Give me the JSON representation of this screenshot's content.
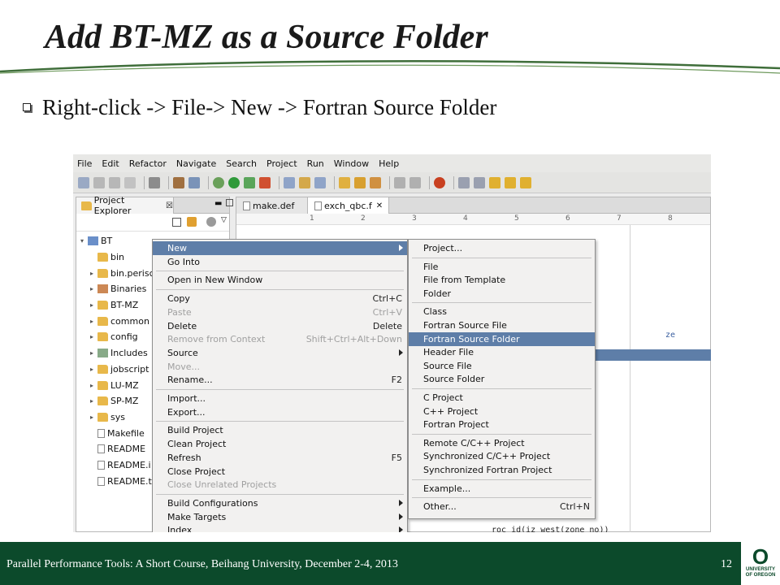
{
  "slide": {
    "title": "Add BT-MZ as a Source Folder",
    "bullet": "Right-click -> File-> New -> Fortran Source Folder",
    "footer": "Parallel Performance Tools: A Short Course, Beihang University, December 2-4, 2013",
    "page_number": "12",
    "logo_letter": "O",
    "logo_line1": "UNIVERSITY",
    "logo_line2": "OF OREGON",
    "colors": {
      "footer_bg": "#0c4a2b",
      "swoosh": "#3f6e3a",
      "highlight": "#5e7ea8"
    }
  },
  "ide": {
    "menubar": [
      "File",
      "Edit",
      "Refactor",
      "Navigate",
      "Search",
      "Project",
      "Run",
      "Window",
      "Help"
    ],
    "project_explorer": {
      "tab_label": "Project Explorer",
      "close_glyph": "☒",
      "items": [
        "BT",
        "bin",
        "bin.perisc",
        "Binaries",
        "BT-MZ",
        "common",
        "config",
        "Includes",
        "jobscript",
        "LU-MZ",
        "SP-MZ",
        "sys",
        "Makefile",
        "README",
        "README.i",
        "README.t"
      ]
    },
    "editor": {
      "tabs": [
        "make.def",
        "exch_qbc.f"
      ],
      "ruler": [
        "1",
        "2",
        "3",
        "4",
        "5",
        "6",
        "7",
        "8"
      ],
      "snippet_right": "ze",
      "snippet_bottom": "roc_id(iz_west(zone_no))"
    },
    "context_menu": [
      {
        "label": "New",
        "accel": "",
        "submenu": true,
        "highlight": true
      },
      {
        "label": "Go Into",
        "accel": ""
      },
      {
        "sep": true
      },
      {
        "label": "Open in New Window",
        "accel": ""
      },
      {
        "sep": true
      },
      {
        "label": "Copy",
        "accel": "Ctrl+C"
      },
      {
        "label": "Paste",
        "accel": "Ctrl+V",
        "disabled": true
      },
      {
        "label": "Delete",
        "accel": "Delete"
      },
      {
        "label": "Remove from Context",
        "accel": "Shift+Ctrl+Alt+Down",
        "disabled": true
      },
      {
        "label": "Source",
        "accel": "",
        "submenu": true
      },
      {
        "label": "Move...",
        "accel": "",
        "disabled": true
      },
      {
        "label": "Rename...",
        "accel": "F2"
      },
      {
        "sep": true
      },
      {
        "label": "Import...",
        "accel": ""
      },
      {
        "label": "Export...",
        "accel": ""
      },
      {
        "sep": true
      },
      {
        "label": "Build Project",
        "accel": ""
      },
      {
        "label": "Clean Project",
        "accel": ""
      },
      {
        "label": "Refresh",
        "accel": "F5"
      },
      {
        "label": "Close Project",
        "accel": ""
      },
      {
        "label": "Close Unrelated Projects",
        "accel": "",
        "disabled": true
      },
      {
        "sep": true
      },
      {
        "label": "Build Configurations",
        "accel": "",
        "submenu": true
      },
      {
        "label": "Make Targets",
        "accel": "",
        "submenu": true
      },
      {
        "label": "Index",
        "accel": "",
        "submenu": true
      }
    ],
    "new_submenu": [
      {
        "label": "Project...",
        "accel": ""
      },
      {
        "sep": true
      },
      {
        "label": "File",
        "accel": ""
      },
      {
        "label": "File from Template",
        "accel": ""
      },
      {
        "label": "Folder",
        "accel": ""
      },
      {
        "sep": true
      },
      {
        "label": "Class",
        "accel": ""
      },
      {
        "label": "Fortran Source File",
        "accel": ""
      },
      {
        "label": "Fortran Source Folder",
        "accel": "",
        "highlight": true
      },
      {
        "label": "Header File",
        "accel": ""
      },
      {
        "label": "Source File",
        "accel": ""
      },
      {
        "label": "Source Folder",
        "accel": ""
      },
      {
        "sep": true
      },
      {
        "label": "C Project",
        "accel": ""
      },
      {
        "label": "C++ Project",
        "accel": ""
      },
      {
        "label": "Fortran Project",
        "accel": ""
      },
      {
        "sep": true
      },
      {
        "label": "Remote C/C++ Project",
        "accel": ""
      },
      {
        "label": "Synchronized C/C++ Project",
        "accel": ""
      },
      {
        "label": "Synchronized Fortran Project",
        "accel": ""
      },
      {
        "sep": true
      },
      {
        "label": "Example...",
        "accel": ""
      },
      {
        "sep": true
      },
      {
        "label": "Other...",
        "accel": "Ctrl+N"
      }
    ]
  }
}
